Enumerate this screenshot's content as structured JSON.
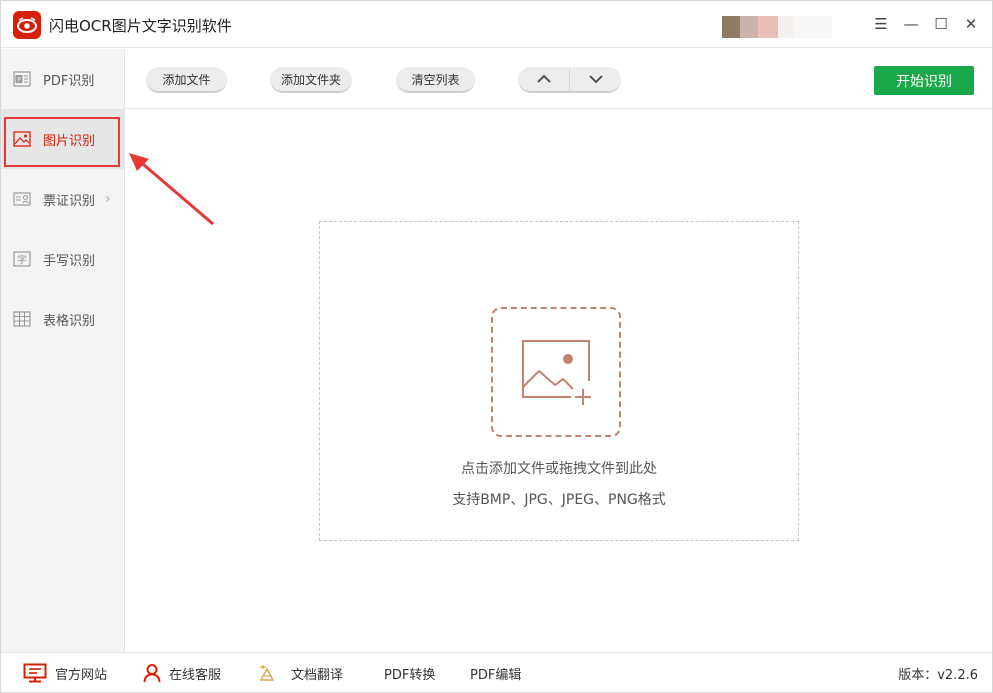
{
  "app": {
    "title": "闪电OCR图片文字识别软件"
  },
  "window_controls": {
    "menu": "☰",
    "minimize": "—",
    "maximize": "☐",
    "close": "✕"
  },
  "sidebar": {
    "items": [
      {
        "label": "PDF识别",
        "icon": "pdf-icon",
        "active": false
      },
      {
        "label": "图片识别",
        "icon": "image-icon",
        "active": true
      },
      {
        "label": "票证识别",
        "icon": "id-card-icon",
        "active": false,
        "has_submenu": true
      },
      {
        "label": "手写识别",
        "icon": "handwriting-icon",
        "active": false
      },
      {
        "label": "表格识别",
        "icon": "table-icon",
        "active": false
      }
    ]
  },
  "toolbar": {
    "add_file": "添加文件",
    "add_folder": "添加文件夹",
    "clear_list": "清空列表",
    "move_up_icon": "chevron-up-icon",
    "move_down_icon": "chevron-down-icon",
    "start": "开始识别"
  },
  "dropzone": {
    "hint": "点击添加文件或拖拽文件到此处",
    "formats": "支持BMP、JPG、JPEG、PNG格式"
  },
  "footer": {
    "website": "官方网站",
    "support": "在线客服",
    "translate": "文档翻译",
    "pdf_convert": "PDF转换",
    "pdf_edit": "PDF编辑",
    "version": "版本：v2.2.6"
  },
  "colors": {
    "brand_red": "#d81e06",
    "start_green": "#1ba84a",
    "upload_brown": "#c08470",
    "annotation_red": "#e53935"
  }
}
